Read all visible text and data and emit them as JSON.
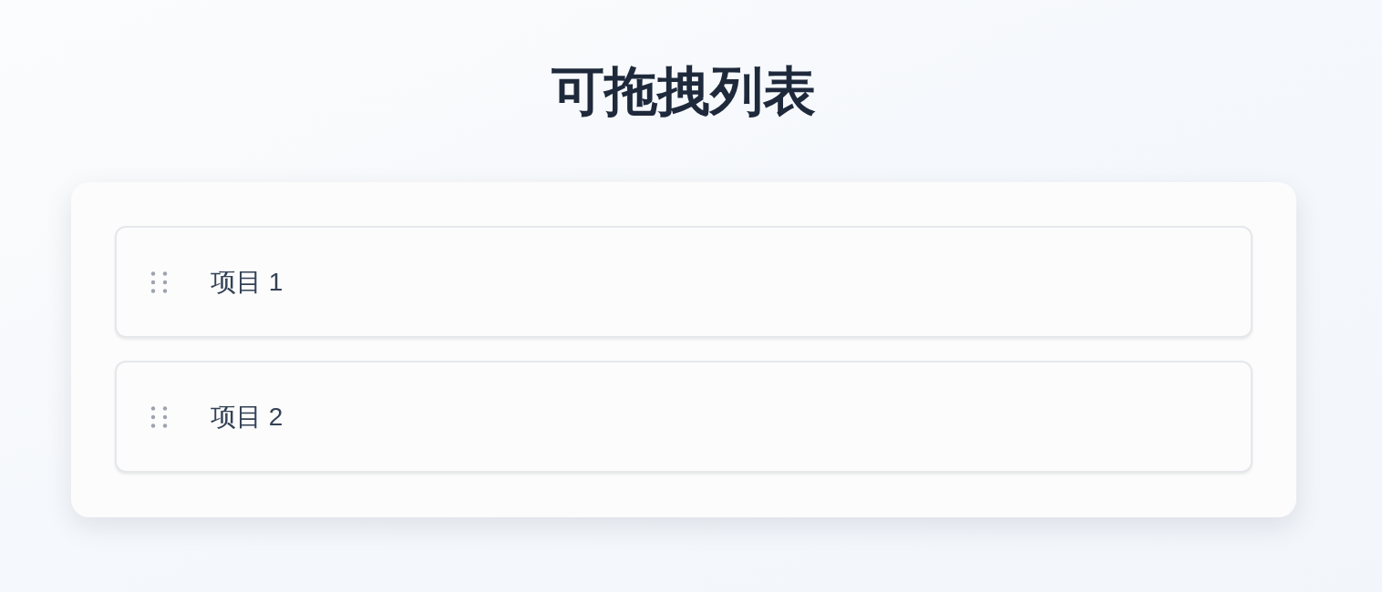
{
  "title": "可拖拽列表",
  "items": [
    {
      "label": "项目 1"
    },
    {
      "label": "项目 2"
    }
  ]
}
